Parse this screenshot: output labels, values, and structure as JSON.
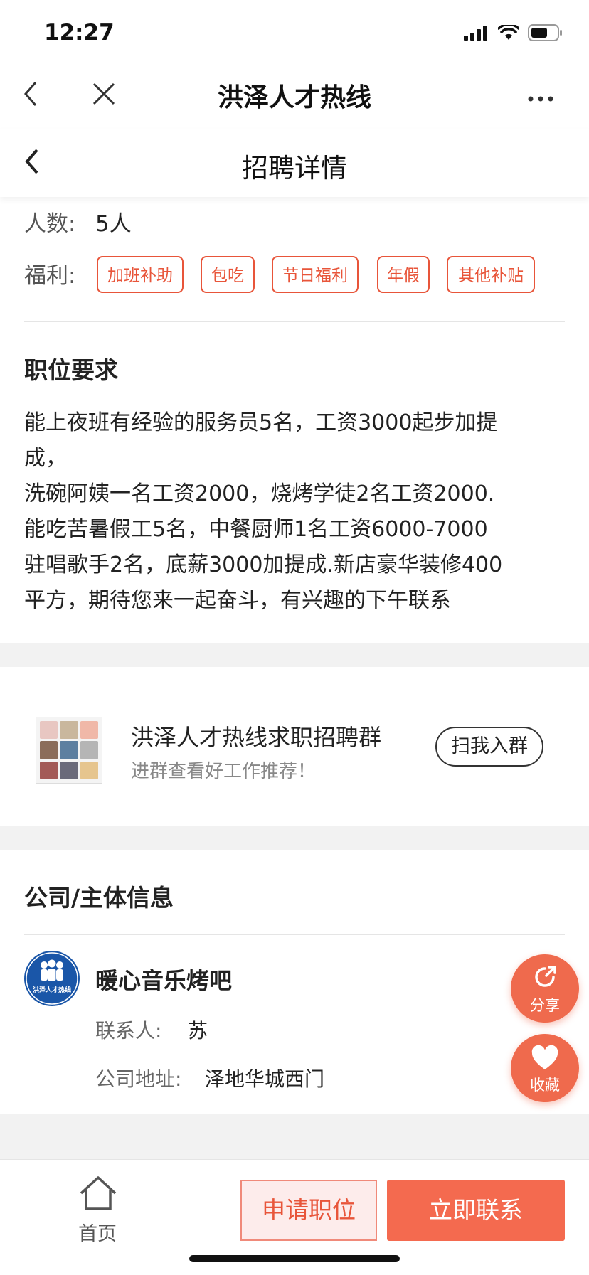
{
  "status_bar": {
    "time": "12:27"
  },
  "wechat_nav": {
    "title": "洪泽人才热线"
  },
  "page_header": {
    "title": "招聘详情"
  },
  "job": {
    "headcount_label": "人数:",
    "headcount_value": "5人",
    "benefits_label": "福利:",
    "benefits": [
      "加班补助",
      "包吃",
      "节日福利",
      "年假",
      "其他补贴"
    ],
    "requirements_title": "职位要求",
    "requirements_lines": [
      "能上夜班有经验的服务员5名，工资3000起步加提",
      "成，",
      "洗碗阿姨一名工资2000，烧烤学徒2名工资2000.",
      "能吃苦暑假工5名，中餐厨师1名工资6000-7000",
      "驻唱歌手2名，底薪3000加提成.新店豪华装修400",
      "平方，期待您来一起奋斗，有兴趣的下午联系"
    ]
  },
  "group": {
    "name": "洪泽人才热线求职招聘群",
    "subtitle": "进群查看好工作推荐！",
    "join_label": "扫我入群"
  },
  "company": {
    "section_title": "公司/主体信息",
    "logo_text": "洪泽人才热线",
    "name": "暖心音乐烤吧",
    "contact_label": "联系人:",
    "contact_value": "苏",
    "address_label": "公司地址:",
    "address_value": "泽地华城西门"
  },
  "floating": {
    "share_label": "分享",
    "favorite_label": "收藏"
  },
  "bottom_bar": {
    "home_label": "首页",
    "apply_label": "申请职位",
    "contact_label": "立即联系"
  },
  "colors": {
    "accent": "#e8553a",
    "float": "#ef6a4d",
    "contact_button": "#f46a4f"
  }
}
